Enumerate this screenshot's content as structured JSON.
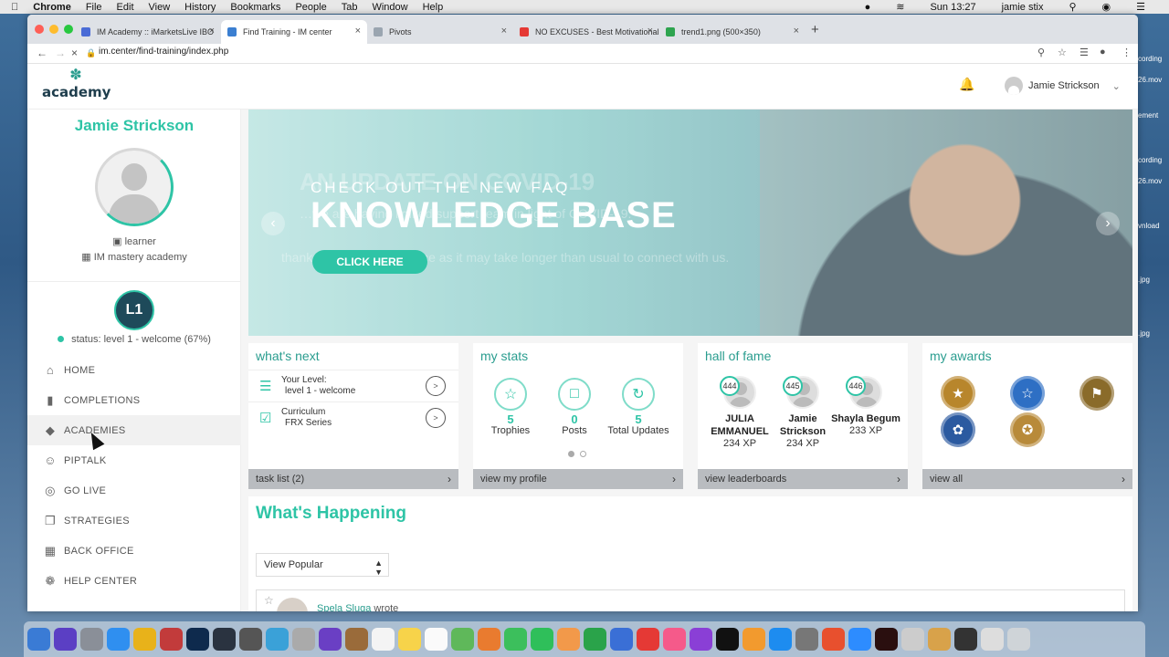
{
  "menubar": {
    "app": "Chrome",
    "items": [
      "File",
      "Edit",
      "View",
      "History",
      "Bookmarks",
      "People",
      "Tab",
      "Window",
      "Help"
    ],
    "clock": "Sun 13:27",
    "user": "jamie stix"
  },
  "desktop_files": [
    "cording",
    "26.mov",
    "ement",
    "cording",
    "26.mov",
    "vnload",
    ".jpg",
    ".jpg"
  ],
  "browser": {
    "tabs": [
      {
        "title": "IM Academy :: iMarketsLive IBO",
        "fav_color": "#4a6bd6"
      },
      {
        "title": "Find Training - IM center",
        "fav_color": "#3b7fd1"
      },
      {
        "title": "Pivots",
        "fav_color": "#9aa5b0"
      },
      {
        "title": "NO EXCUSES - Best Motivational",
        "fav_color": "#e53935"
      },
      {
        "title": "trend1.png (500×350)",
        "fav_color": "#2ea44f"
      }
    ],
    "url": "im.center/find-training/index.php"
  },
  "header": {
    "logo_text": "academy",
    "user_name": "Jamie Strickson"
  },
  "sidebar": {
    "name": "Jamie Strickson",
    "role": "learner",
    "organization": "IM mastery academy",
    "level_badge": "L1",
    "status_label": "status:",
    "status_value": "level 1 - welcome (67%)",
    "items": [
      {
        "label": "HOME",
        "icon": "home-icon"
      },
      {
        "label": "COMPLETIONS",
        "icon": "bookmark-icon"
      },
      {
        "label": "ACADEMIES",
        "icon": "graduation-cap-icon"
      },
      {
        "label": "PIPTALK",
        "icon": "people-icon"
      },
      {
        "label": "GO LIVE",
        "icon": "globe-icon"
      },
      {
        "label": "STRATEGIES",
        "icon": "copy-icon"
      },
      {
        "label": "BACK OFFICE",
        "icon": "grid-icon"
      },
      {
        "label": "HELP CENTER",
        "icon": "help-icon"
      }
    ]
  },
  "banner": {
    "ghost_title": "AN UPDATE ON COVID-19",
    "ghost_line": "…we are having limited support team in light of COVID-19.",
    "ghost_line2": "thank you for your patience as it may take longer than usual to connect with us.",
    "kicker": "CHECK OUT THE NEW FAQ",
    "headline": "KNOWLEDGE BASE",
    "cta": "CLICK HERE"
  },
  "cards": {
    "whats_next": {
      "title": "what's next",
      "rows": [
        {
          "line1": "Your Level:",
          "line2": "level 1 - welcome"
        },
        {
          "line1": "Curriculum",
          "line2": "FRX Series"
        }
      ],
      "footer": "task list (2)"
    },
    "my_stats": {
      "title": "my stats",
      "stats": [
        {
          "value": "5",
          "label": "Trophies"
        },
        {
          "value": "0",
          "label": "Posts"
        },
        {
          "value": "5",
          "label": "Total Updates"
        }
      ],
      "footer": "view my profile"
    },
    "hall_of_fame": {
      "title": "hall of fame",
      "people": [
        {
          "rank": "444",
          "name": "JULIA EMMANUEL",
          "xp": "234 XP"
        },
        {
          "rank": "445",
          "name": "Jamie Strickson",
          "xp": "234 XP"
        },
        {
          "rank": "446",
          "name": "Shayla Begum",
          "xp": "233 XP"
        }
      ],
      "footer": "view leaderboards"
    },
    "my_awards": {
      "title": "my awards",
      "awards": [
        {
          "name": "star-medal-icon",
          "color": "#b8862c"
        },
        {
          "name": "trophy-medal-icon",
          "color": "#2e6fc4"
        },
        {
          "name": "flag-medal-icon",
          "color": "#8a6b2a"
        },
        {
          "name": "ribbon-medal-icon",
          "color": "#2b5aa0"
        },
        {
          "name": "rosette-medal-icon",
          "color": "#b88a3a"
        }
      ],
      "footer": "view all"
    }
  },
  "whats_happening": {
    "title": "What's Happening",
    "sort_value": "View Popular",
    "post_author": "Spela Sluga",
    "post_action": "wrote"
  },
  "colors": {
    "accent": "#2ec4a6",
    "title_teal": "#2a9d8f",
    "navy": "#1e4a5a"
  }
}
